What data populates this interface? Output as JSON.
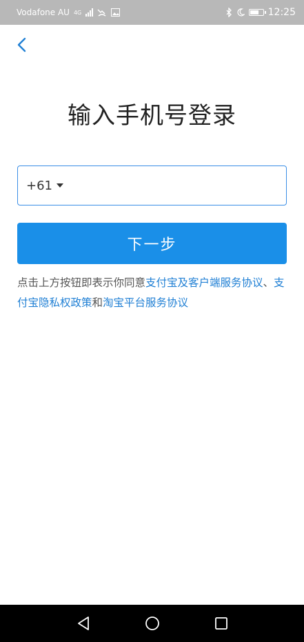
{
  "status_bar": {
    "carrier": "Vodafone AU",
    "network": "4G",
    "time": "12:25"
  },
  "title": "输入手机号登录",
  "phone_input": {
    "country_code": "+61",
    "value": "",
    "placeholder": ""
  },
  "next_button_label": "下一步",
  "agreement": {
    "prefix": "点击上方按钮即表示你同意",
    "link1": "支付宝及客户端服务协议",
    "sep": "、",
    "link2": "支付宝隐私权政策",
    "and": "和",
    "link3": "淘宝平台服务协议"
  },
  "colors": {
    "accent": "#1a8fe8",
    "link": "#1f7fd4",
    "status_bar_bg": "#b8b8b8",
    "nav_bar_bg": "#000000"
  },
  "icons": {
    "back": "chevron-left-icon",
    "nav_back": "triangle-back-icon",
    "nav_home": "circle-home-icon",
    "nav_recent": "square-recent-icon"
  }
}
